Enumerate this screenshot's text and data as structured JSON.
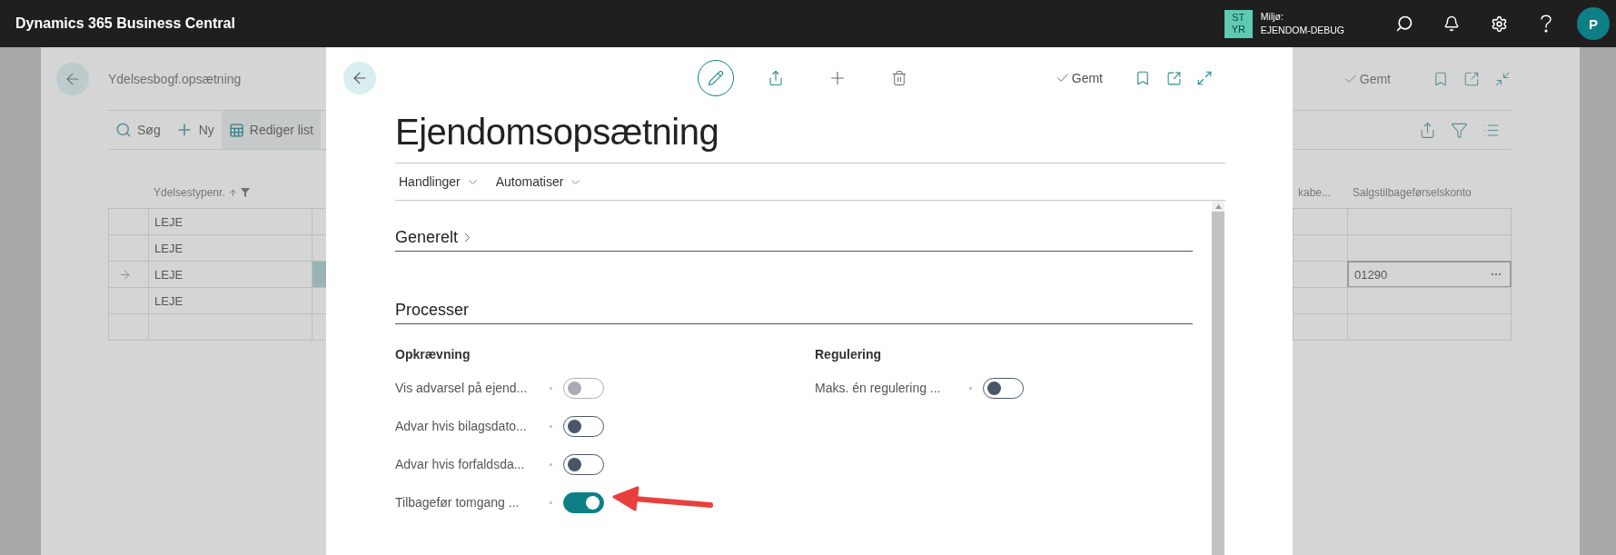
{
  "app_bar": {
    "title": "Dynamics 365 Business Central",
    "badge_lines": [
      "ST",
      "YR"
    ],
    "environment_label": "Miljø:",
    "environment_name": "EJENDOM-DEBUG",
    "avatar": "P"
  },
  "background_page": {
    "title": "Ydelsesbogf.opsætning",
    "status": "Gemt",
    "actions": [
      {
        "label": "Søg",
        "kind": "search",
        "highlighted": false
      },
      {
        "label": "Ny",
        "kind": "new",
        "highlighted": false
      },
      {
        "label": "Rediger list",
        "kind": "edit-list",
        "highlighted": true
      }
    ],
    "table": {
      "columns": [
        {
          "label": "Ydelsestypenr.",
          "sorted": true,
          "filtered": true
        },
        {
          "label": "kabe..."
        },
        {
          "label": "Salgstilbageførselskonto"
        }
      ],
      "rows": [
        {
          "type": "LEJE",
          "selected": false
        },
        {
          "type": "LEJE",
          "selected": false
        },
        {
          "type": "LEJE",
          "account": "01290",
          "selected": true
        },
        {
          "type": "LEJE",
          "selected": false
        },
        {
          "selected": false
        }
      ]
    }
  },
  "dialog": {
    "title": "Ejendomsopsætning",
    "status": "Gemt",
    "menu": [
      "Handlinger",
      "Automatiser"
    ],
    "sections": [
      {
        "title": "Generelt",
        "expanded": false
      },
      {
        "title": "Processer",
        "expanded": true,
        "groups": [
          {
            "title": "Opkrævning",
            "fields": [
              {
                "label": "Vis advarsel på ejend...",
                "on": false,
                "disabled": true
              },
              {
                "label": "Advar hvis bilagsdato...",
                "on": false,
                "disabled": false
              },
              {
                "label": "Advar hvis forfaldsda...",
                "on": false,
                "disabled": false
              },
              {
                "label": "Tilbagefør tomgang ...",
                "on": true,
                "disabled": false
              }
            ]
          },
          {
            "title": "Regulering",
            "fields": [
              {
                "label": "Maks. én regulering ...",
                "on": false,
                "disabled": false
              }
            ]
          }
        ]
      }
    ]
  }
}
